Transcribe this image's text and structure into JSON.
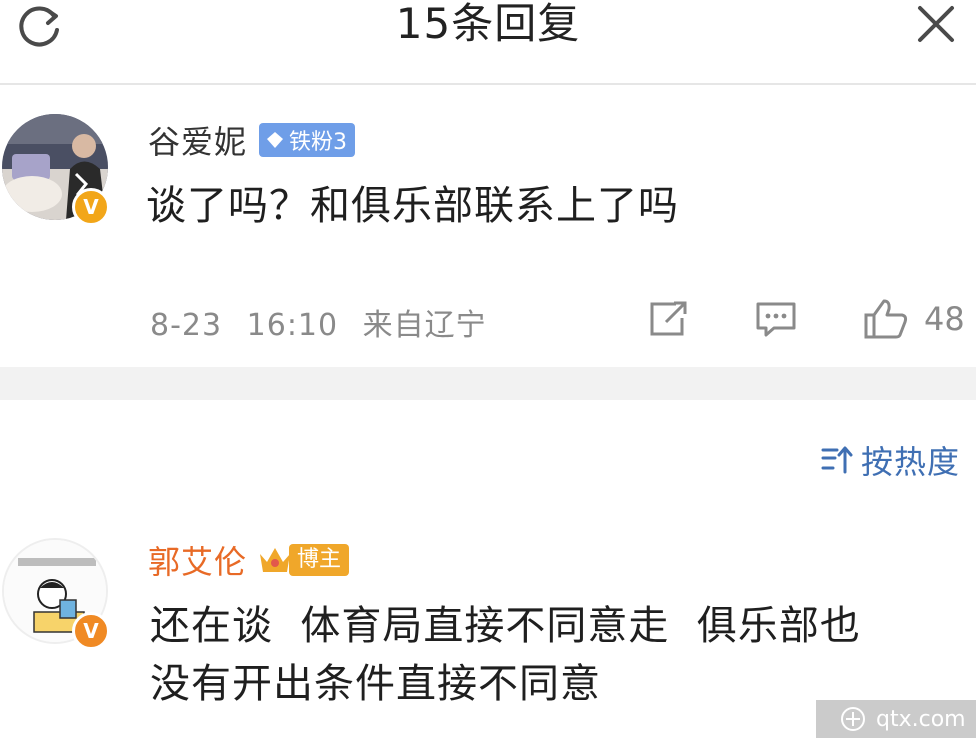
{
  "header": {
    "title": "15条回复"
  },
  "main_comment": {
    "username": "谷爱妮",
    "fan_badge": "铁粉3",
    "text": "谈了吗？和俱乐部联系上了吗",
    "date": "8-23",
    "time": "16:10",
    "location": "来自辽宁",
    "likes": "48"
  },
  "sort": {
    "label": "按热度"
  },
  "reply": {
    "username": "郭艾伦",
    "badge": "博主",
    "text_line1": "还在谈  体育局直接不同意走  俱乐部也",
    "text_line2": "没有开出条件直接不同意"
  },
  "watermark": {
    "text": "qtx.com"
  },
  "colors": {
    "link_blue": "#3f6fb3",
    "fan_badge": "#6f9ee8",
    "blogger_name": "#e86a26",
    "verified": "#f2a619",
    "meta_gray": "#8a8a8a"
  },
  "icons": [
    "refresh-icon",
    "close-icon",
    "share-icon",
    "comment-icon",
    "like-icon",
    "sort-icon",
    "diamond-icon",
    "crown-icon",
    "verified-badge-icon"
  ]
}
